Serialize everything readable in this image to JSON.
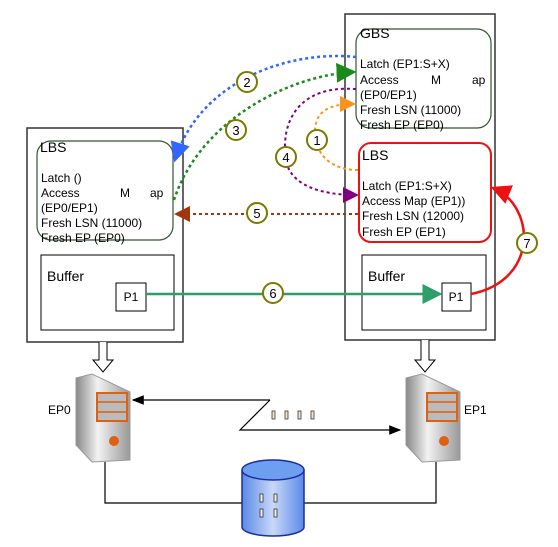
{
  "left_node": {
    "lbs": {
      "title": "LBS",
      "lines": [
        "Latch ()",
        "Access",
        "M",
        "ap",
        "(EP0/EP1)",
        "Fresh LSN (11000)",
        "Fresh EP (EP0)"
      ]
    },
    "buffer": {
      "title": "Buffer",
      "page": "P1"
    },
    "server_label": "EP0"
  },
  "right_node": {
    "gbs": {
      "title": "GBS",
      "lines": [
        "Latch (EP1:S+X)",
        "Access",
        "M",
        "ap",
        "(EP0/EP1)",
        "Fresh LSN (11000)",
        "Fresh EP (EP0)"
      ]
    },
    "lbs": {
      "title": "LBS",
      "lines": [
        "Latch  (EP1:S+X)",
        "Access Map (EP1))",
        "Fresh LSN (12000)",
        "Fresh EP (EP1)"
      ]
    },
    "buffer": {
      "title": "Buffer",
      "page": "P1"
    },
    "server_label": "EP1"
  },
  "steps": [
    "1",
    "2",
    "3",
    "4",
    "5",
    "6",
    "7"
  ],
  "colors": {
    "step1": "#f7941d",
    "step2": "#3366ff",
    "step3": "#1a8a1a",
    "step4": "#800080",
    "step5": "#a0360a",
    "step6": "#2e9e6a",
    "step7": "#ee1111",
    "gbs_border": "#335533",
    "lbs_active_border": "#ee1111",
    "step_circle": "#7a7a00",
    "database": "#6d9ef0"
  }
}
